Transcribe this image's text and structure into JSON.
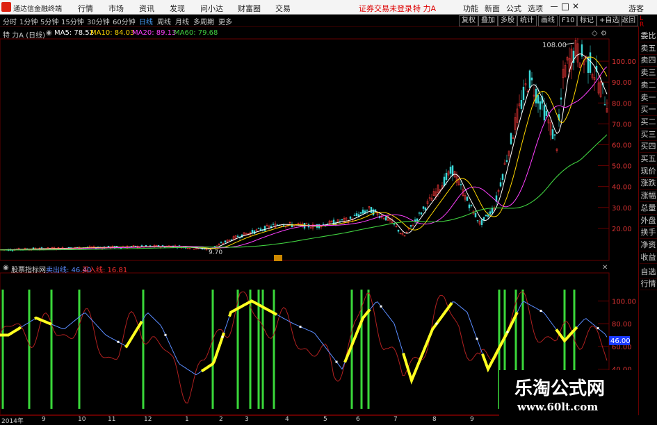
{
  "menubar": {
    "app_title": "通达信金融终端",
    "items": [
      "行情",
      "市场",
      "资讯",
      "发现",
      "问小达",
      "财富圈",
      "交易"
    ],
    "login_notice": "证券交易未登录",
    "stock_name": "特 力A",
    "right_items": [
      "功能",
      "新面",
      "公式",
      "选项"
    ],
    "guest": "游客"
  },
  "toolbar": {
    "periods": [
      "分时",
      "1分钟",
      "5分钟",
      "15分钟",
      "30分钟",
      "60分钟",
      "日线",
      "周线",
      "月线",
      "多周期",
      "更多"
    ],
    "active_period": "日线",
    "buttons": [
      "复权",
      "叠加",
      "多股",
      "统计",
      "画线",
      "F10",
      "标记",
      "+自选",
      "返回"
    ]
  },
  "main_legend": {
    "title": "特 力A (日线)",
    "ma5": "MA5: 78.52",
    "ma10": "MA10: 84.03",
    "ma20": "MA20: 89.13",
    "ma60": "MA60: 79.68"
  },
  "main_chart": {
    "y_ticks": [
      "100.00",
      "90.00",
      "80.00",
      "70.00",
      "60.00",
      "50.00",
      "40.00",
      "30.00",
      "20.00"
    ],
    "high_label": "108.00",
    "low_label": "9.70",
    "colors": {
      "ma5": "#ffffff",
      "ma10": "#ffd700",
      "ma20": "#ff40ff",
      "ma60": "#40d040"
    }
  },
  "sub_legend": {
    "title": "股票指标网",
    "sell_line": "卖出线: 46.40",
    "buy_line": "买入线: 16.81"
  },
  "sub_chart": {
    "y_ticks": [
      "100.00",
      "80.00",
      "60.00",
      "40.00"
    ],
    "current_value": "46.00"
  },
  "right_panel": {
    "items": [
      "委比",
      "卖五",
      "卖四",
      "卖三",
      "卖二",
      "卖一",
      "买一",
      "买二",
      "买三",
      "买四",
      "买五",
      "现价",
      "涨跌",
      "涨幅",
      "总量",
      "外盘",
      "换手",
      "净资",
      "收益"
    ],
    "sub_items": [
      "自选",
      "行情"
    ]
  },
  "x_axis": {
    "labels": [
      "2014年",
      "9",
      "10",
      "11",
      "12",
      "1",
      "2",
      "3",
      "4",
      "5",
      "6",
      "7",
      "8",
      "9"
    ]
  },
  "watermark": {
    "title": "乐淘公式网",
    "url": "www.60lt.com"
  },
  "chart_data": {
    "type": "line",
    "title": "特 力A (日线)",
    "series": [
      {
        "name": "MA5",
        "values": [
          9.7,
          10.5,
          11.2,
          12.0,
          13.5,
          15.8,
          18.5,
          21.0,
          24.0,
          27.5,
          29.0,
          22.0,
          16.5,
          25.0,
          42.0,
          47.5,
          30.0,
          22.0,
          45.0,
          80.0,
          90.0,
          82.0,
          96.0,
          104.0,
          98.0,
          78.52
        ]
      },
      {
        "name": "MA60",
        "values": [
          9.7,
          10.0,
          10.5,
          11.0,
          11.8,
          12.8,
          14.0,
          15.5,
          17.0,
          18.5,
          20.0,
          20.5,
          20.0,
          20.5,
          21.5,
          23.0,
          23.5,
          23.0,
          26.0,
          36.0,
          48.0,
          55.0,
          63.0,
          70.0,
          76.0,
          79.68
        ]
      }
    ],
    "ylim": [
      5,
      110
    ]
  }
}
